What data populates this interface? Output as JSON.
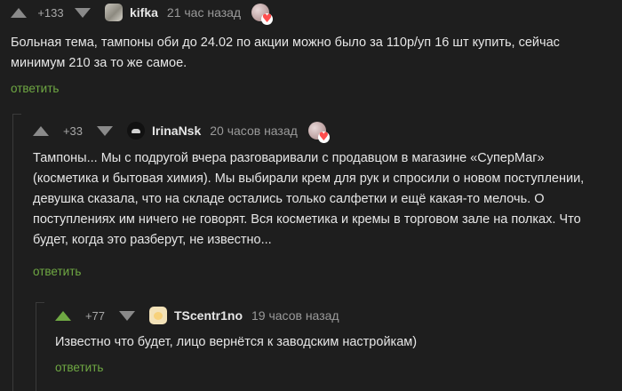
{
  "comments": [
    {
      "rating": "+133",
      "username": "kifka",
      "time": "21 час назад",
      "text": "Больная тема, тампоны оби до 24.02 по акции можно было за 110р/уп 16 шт  купить, сейчас минимум 210 за то же самое.",
      "reply": "ответить",
      "avatar_icon": "cat-avatar-icon",
      "upvoted": false
    },
    {
      "rating": "+33",
      "username": "IrinaNsk",
      "time": "20 часов назад",
      "text": "Тампоны... Мы с подругой вчера разговаривали с продавцом в магазине «СуперМаг» (косметика и бытовая химия). Мы выбирали крем для рук и спросили о новом поступлении, девушка сказала, что на складе остались только салфетки и ещё какая-то мелочь. О поступлениях им ничего не говорят. Вся косметика и кремы в торговом зале на полках. Что будет, когда это разберут, не известно...",
      "reply": "ответить",
      "avatar_icon": "car-avatar-icon",
      "upvoted": false
    },
    {
      "rating": "+77",
      "username": "TScentr1no",
      "time": "19 часов назад",
      "text": "Известно что будет, лицо вернётся к заводским настройкам)",
      "reply": "ответить",
      "avatar_icon": "character-avatar-icon",
      "upvoted": true
    }
  ],
  "colors": {
    "background": "#1e1e1e",
    "accent_green": "#6fa843",
    "muted": "#8a8a8a"
  }
}
